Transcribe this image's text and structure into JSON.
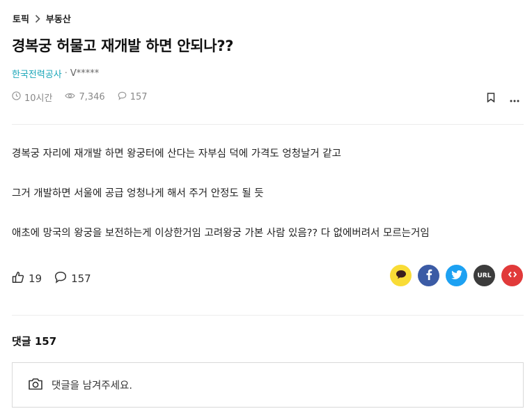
{
  "breadcrumb": {
    "topic": "토픽",
    "category": "부동산"
  },
  "post": {
    "title": "경복궁 허물고 재개발 하면 안되나??",
    "company": "한국전력공사",
    "separator": "·",
    "nickname": "V*****",
    "time": "10시간",
    "views": "7,346",
    "comment_count": "157",
    "body": [
      "경복궁 자리에 재개발 하면 왕궁터에 산다는 자부심 덕에 가격도 엉청날거 같고",
      "그거 개발하면 서울에 공급 엉청나게 해서 주거 안정도 될 듯",
      "애초에 망국의 왕궁을 보전하는게 이상한거임 고려왕궁 가본 사람 있음?? 다 없에버려서 모르는거임"
    ],
    "likes": "19",
    "comments": "157"
  },
  "share": {
    "url_label": "URL"
  },
  "comments_section": {
    "heading": "댓글 157",
    "placeholder": "댓글을 남겨주세요."
  },
  "colors": {
    "accent": "#19a6b8",
    "kakao": "#f9dc36",
    "facebook": "#3b5ba5",
    "twitter": "#1da1f2",
    "url": "#3c3c3c",
    "embed": "#e13a3a"
  }
}
